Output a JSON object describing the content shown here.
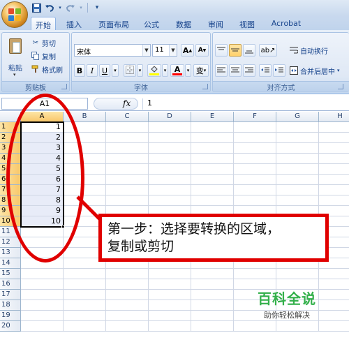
{
  "quick_access": {
    "icons": [
      "save-icon",
      "undo-icon",
      "redo-icon",
      "customize-icon"
    ]
  },
  "tabs": [
    "开始",
    "插入",
    "页面布局",
    "公式",
    "数据",
    "审阅",
    "视图",
    "Acrobat"
  ],
  "active_tab": "开始",
  "clipboard": {
    "paste_label": "粘贴",
    "cut_label": "剪切",
    "copy_label": "复制",
    "format_painter_label": "格式刷",
    "group_label": "剪贴板"
  },
  "font": {
    "font_name": "宋体",
    "font_size": "11",
    "grow_label": "A",
    "shrink_label": "A",
    "bold_label": "B",
    "italic_label": "I",
    "underline_label": "U",
    "phonetic_label": "变",
    "group_label": "字体",
    "fill_color": "#ffff00",
    "font_color": "#ff0000"
  },
  "alignment": {
    "wrap_text_label": "自动换行",
    "merge_center_label": "合并后居中",
    "group_label": "对齐方式"
  },
  "formula_bar": {
    "name_box": "A1",
    "fx_label": "fx",
    "value": "1"
  },
  "columns": [
    "A",
    "B",
    "C",
    "D",
    "E",
    "F",
    "G",
    "H"
  ],
  "rows": [
    "1",
    "2",
    "3",
    "4",
    "5",
    "6",
    "7",
    "8",
    "9",
    "10",
    "11",
    "12",
    "13",
    "14",
    "15",
    "16",
    "17",
    "18",
    "19",
    "20"
  ],
  "cells_a": [
    "1",
    "2",
    "3",
    "4",
    "5",
    "6",
    "7",
    "8",
    "9",
    "10"
  ],
  "annotation": {
    "line1": "第一步：选择要转换的区域，",
    "line2": "复制或剪切",
    "color": "#e00000"
  },
  "watermark": {
    "main": "百科全说",
    "sub": "助你轻松解决"
  }
}
